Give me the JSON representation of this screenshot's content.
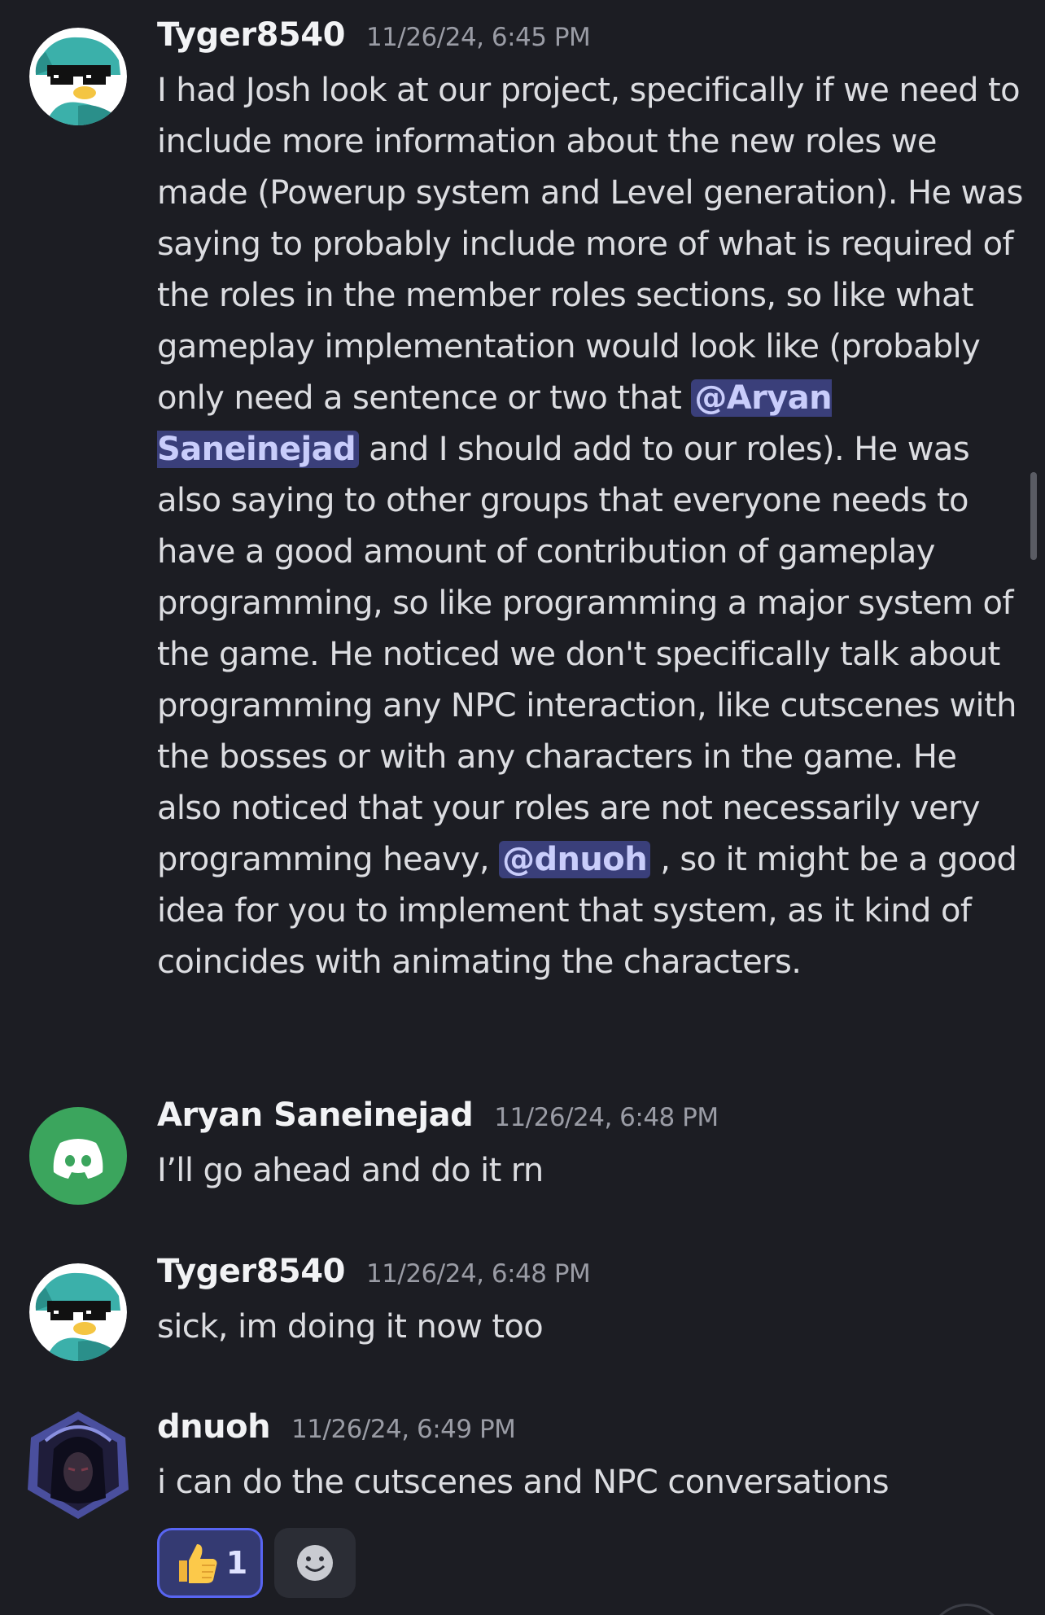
{
  "messages": [
    {
      "author": "Tyger8540",
      "timestamp": "11/26/24, 6:45 PM",
      "avatar": "penguin-sunglasses-avatar",
      "text_parts": [
        "I had Josh look at our project, specifically if we need to include more information about the new roles we made (Powerup system and Level generation). He was saying to probably include more of what is required of the roles in the member roles sections, so like what gameplay implementation would look like (probably only need a sentence or two that ",
        " and I should add to our roles). He was also saying to other groups that everyone needs to have a good amount of contribution of gameplay programming, so like programming a major system of the game. He noticed we don't specifically talk about programming any NPC interaction, like cutscenes with the bosses or with any characters in the game. He also noticed that your roles are not necessarily very programming heavy, ",
        " , so it might be a good idea for you to implement that system, as it kind of coincides with animating the characters."
      ],
      "mentions": [
        "@Aryan Saneinejad",
        "@dnuoh"
      ]
    },
    {
      "author": "Aryan Saneinejad",
      "timestamp": "11/26/24, 6:48 PM",
      "avatar": "discord-logo-avatar",
      "text": "I’ll go ahead and do it rn"
    },
    {
      "author": "Tyger8540",
      "timestamp": "11/26/24, 6:48 PM",
      "avatar": "penguin-sunglasses-avatar",
      "text": "sick, im doing it now too"
    },
    {
      "author": "dnuoh",
      "timestamp": "11/26/24, 6:49 PM",
      "avatar": "hooded-figure-avatar",
      "text": "i can do the cutscenes and NPC conversations",
      "reactions": [
        {
          "emoji": "👍",
          "count": "1",
          "icon": "thumbs-up-icon"
        }
      ]
    }
  ],
  "colors": {
    "background": "#1c1d23",
    "mention_bg": "#3a3f7a",
    "mention_text": "#c9cdfb",
    "discord_green": "#3ba55d",
    "reaction_active": "#5865f2"
  }
}
